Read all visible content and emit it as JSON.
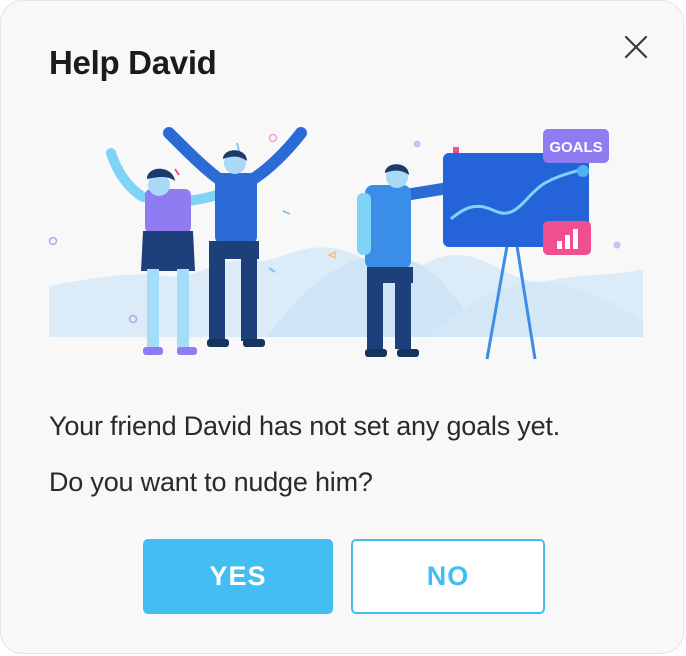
{
  "dialog": {
    "title": "Help David",
    "message_line1": "Your friend David has not set any goals yet.",
    "message_line2": "Do you want to nudge him?",
    "yes_label": "YES",
    "no_label": "NO",
    "close_icon": "close-icon"
  },
  "illustration": {
    "board_label": "GOALS",
    "icons": [
      "people-celebrating",
      "presenter",
      "goals-board",
      "bar-chart-icon"
    ]
  },
  "colors": {
    "accent": "#42bef3",
    "title": "#1b1b1d",
    "text": "#2a2a2e",
    "background": "#f8f8f9",
    "badge_purple": "#8f7bf2",
    "badge_pink": "#ef4e8f",
    "board_blue": "#2563d9"
  }
}
